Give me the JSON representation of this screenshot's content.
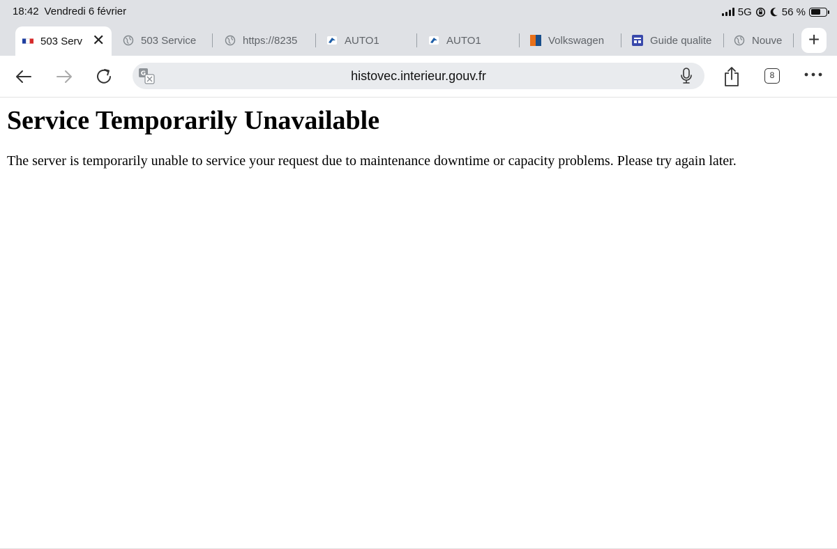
{
  "status_bar": {
    "time": "18:42",
    "date": "Vendredi 6 février",
    "network": "5G",
    "battery_percent": "56 %",
    "battery_level": 0.56
  },
  "tabs": [
    {
      "label": "503 Serv",
      "icon": "french-flag-icon",
      "active": true
    },
    {
      "label": "503 Service",
      "icon": "globe-icon"
    },
    {
      "label": "https://8235",
      "icon": "globe-icon"
    },
    {
      "label": "AUTO1",
      "icon": "auto1-logo-icon"
    },
    {
      "label": "AUTO1",
      "icon": "auto1-logo-icon"
    },
    {
      "label": "Volkswagen",
      "icon": "volkswagen-favicon"
    },
    {
      "label": "Guide qualite",
      "icon": "guide-favicon"
    },
    {
      "label": "Nouve",
      "icon": "globe-icon"
    }
  ],
  "toolbar": {
    "url": "histovec.interieur.gouv.fr",
    "tab_count": "8"
  },
  "page": {
    "heading": "Service Temporarily Unavailable",
    "message": "The server is temporarily unable to service your request due to maintenance downtime or capacity problems. Please try again later."
  },
  "colors": {
    "chrome_bg": "#dfe1e5",
    "address_bg": "#e9ebee",
    "tab_text": "#5f6368"
  }
}
